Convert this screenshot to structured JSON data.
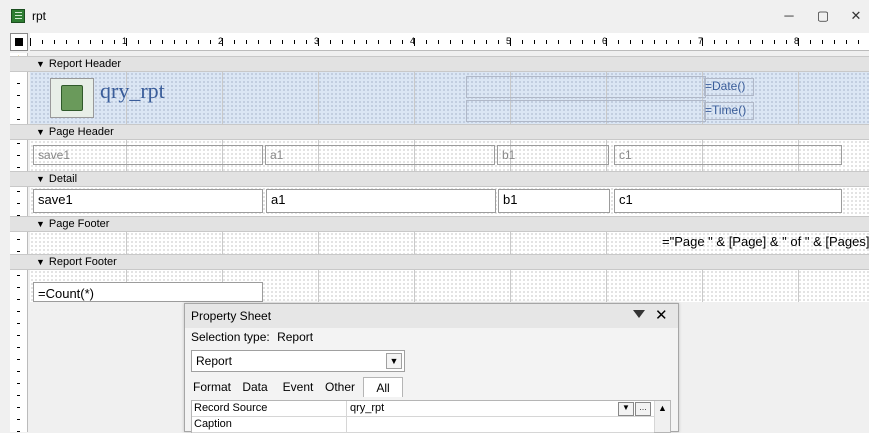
{
  "window": {
    "title": "rpt",
    "minimize": "─",
    "restore": "▢",
    "close": "✕"
  },
  "ruler": {
    "numbers": [
      "1",
      "2",
      "3",
      "4",
      "5",
      "6",
      "7",
      "8"
    ]
  },
  "sections": {
    "report_header": "Report Header",
    "page_header": "Page Header",
    "detail": "Detail",
    "page_footer": "Page Footer",
    "report_footer": "Report Footer"
  },
  "report_header": {
    "title": "qry_rpt",
    "date_expr": "=Date()",
    "time_expr": "=Time()"
  },
  "page_header": {
    "labels": [
      "save1",
      "a1",
      "b1",
      "c1"
    ]
  },
  "detail": {
    "fields": [
      "save1",
      "a1",
      "b1",
      "c1"
    ]
  },
  "page_footer": {
    "expr": "=\"Page \" & [Page] & \" of \" & [Pages]"
  },
  "report_footer": {
    "expr": "=Count(*)"
  },
  "property_sheet": {
    "title": "Property Sheet",
    "selection_type_label": "Selection type:",
    "selection_type_value": "Report",
    "selected_object": "Report",
    "tabs": [
      "Format",
      "Data",
      "Event",
      "Other",
      "All"
    ],
    "active_tab": "All",
    "rows": [
      {
        "name": "Record Source",
        "value": "qry_rpt"
      },
      {
        "name": "Caption",
        "value": ""
      }
    ],
    "close": "✕"
  }
}
